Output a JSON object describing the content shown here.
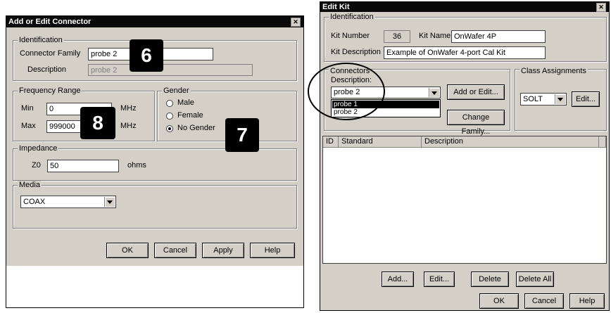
{
  "left_dialog": {
    "title": "Add or Edit Connector",
    "identification": {
      "legend": "Identification",
      "family_label": "Connector Family",
      "family_value": "probe 2",
      "description_label": "Description",
      "description_value": "probe 2"
    },
    "frequency": {
      "legend": "Frequency Range",
      "min_label": "Min",
      "min_value": "0",
      "max_label": "Max",
      "max_value": "999000",
      "unit": "MHz"
    },
    "gender": {
      "legend": "Gender",
      "options": [
        "Male",
        "Female",
        "No Gender"
      ],
      "selected": "No Gender"
    },
    "impedance": {
      "legend": "Impedance",
      "z0_label": "Z0",
      "z0_value": "50",
      "unit": "ohms"
    },
    "media": {
      "legend": "Media",
      "value": "COAX"
    },
    "buttons": {
      "ok": "OK",
      "cancel": "Cancel",
      "apply": "Apply",
      "help": "Help"
    }
  },
  "right_dialog": {
    "title": "Edit Kit",
    "identification": {
      "legend": "Identification",
      "kit_number_label": "Kit Number",
      "kit_number_value": "36",
      "kit_name_label": "Kit Name",
      "kit_name_value": "OnWafer 4P",
      "kit_description_label": "Kit Description",
      "kit_description_value": "Example of OnWafer 4-port Cal Kit"
    },
    "connectors": {
      "legend": "Connectors",
      "description_label": "Description:",
      "selected": "probe 2",
      "options": [
        "probe 1",
        "probe 2"
      ],
      "add_edit_button": "Add or Edit...",
      "change_family_button": "Change Family..."
    },
    "class_assignments": {
      "legend": "Class Assignments",
      "value": "SOLT",
      "edit_button": "Edit..."
    },
    "table": {
      "columns": [
        "ID",
        "Standard",
        "Description"
      ]
    },
    "buttons": {
      "add": "Add...",
      "edit": "Edit...",
      "delete": "Delete",
      "delete_all": "Delete All",
      "ok": "OK",
      "cancel": "Cancel",
      "help": "Help"
    }
  },
  "annotations": {
    "badge_6": "6",
    "badge_7": "7",
    "badge_8": "8"
  },
  "colors": {
    "dialog_bg": "#d4d0c8",
    "title_bg": "#0a0a0a",
    "selection": "#000000"
  }
}
